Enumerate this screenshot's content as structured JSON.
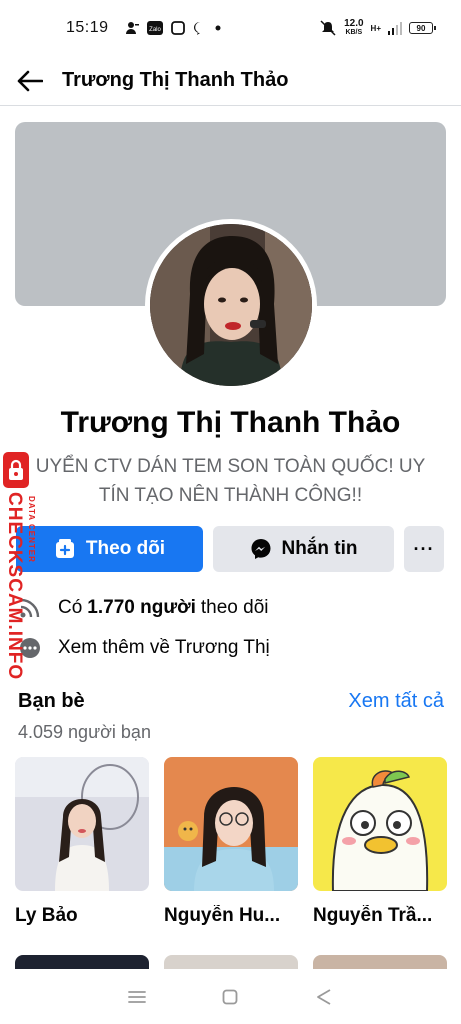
{
  "status_bar": {
    "time": "15:19",
    "net_speed": "12.0",
    "net_unit": "KB/S",
    "signal_label": "H+",
    "battery": "90"
  },
  "header": {
    "back_icon": "arrow-left-icon",
    "title": "Trương Thị Thanh Thảo"
  },
  "profile": {
    "name": "Trương Thị Thanh Thảo",
    "bio": "UYỂN CTV DÁN TEM SON TOÀN QUỐC! UY TÍN TẠO NÊN THÀNH CÔNG!!"
  },
  "actions": {
    "follow_label": "Theo dõi",
    "message_label": "Nhắn tin",
    "more_label": "···"
  },
  "info": {
    "followers_prefix": "Có",
    "followers_count": "1.770 người",
    "followers_suffix": "theo dõi",
    "see_more": "Xem thêm về Trương Thị"
  },
  "friends": {
    "title": "Bạn bè",
    "see_all": "Xem tất cả",
    "count": "4.059 người bạn",
    "items": [
      {
        "name": "Ly Bảo"
      },
      {
        "name": "Nguyễn Hu..."
      },
      {
        "name": "Nguyễn Trầ..."
      }
    ]
  },
  "watermark": {
    "main": "CHECKSCAM.INFO",
    "sub": "DATA CENTER"
  },
  "colors": {
    "accent": "#1877f2",
    "watermark": "#e02424",
    "cover": "#bcc0c4",
    "secondary_text": "#65676b"
  }
}
